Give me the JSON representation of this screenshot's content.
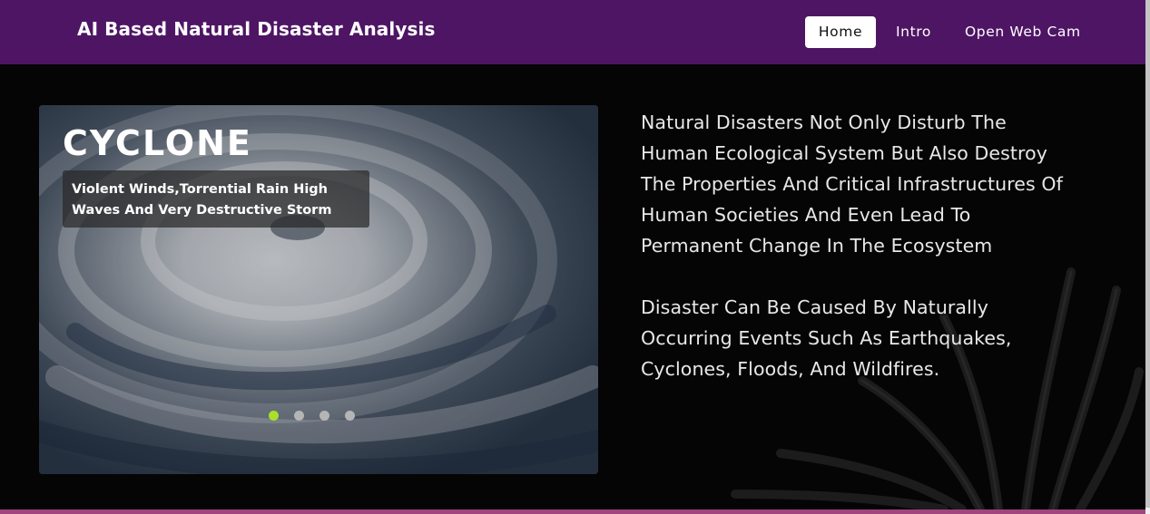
{
  "navbar": {
    "brand": "AI Based Natural Disaster Analysis",
    "items": [
      {
        "label": "Home",
        "active": true
      },
      {
        "label": "Intro",
        "active": false
      },
      {
        "label": "Open Web Cam",
        "active": false
      }
    ],
    "background_color": "#4e1564"
  },
  "carousel": {
    "slide_title": "CYCLONE",
    "slide_caption": "Violent Winds,Torrential Rain High Waves And Very Destructive Storm",
    "slide_count": 4,
    "active_slide": 1,
    "active_dot_color": "#a8e02a"
  },
  "content": {
    "paragraphs": [
      "Natural Disasters Not Only Disturb The Human Ecological System But Also Destroy The Properties And Critical Infrastructures Of Human Societies And Even Lead To Permanent Change In The Ecosystem",
      "Disaster Can Be Caused By Naturally Occurring Events Such As Earthquakes, Cyclones, Floods, And Wildfires."
    ]
  }
}
